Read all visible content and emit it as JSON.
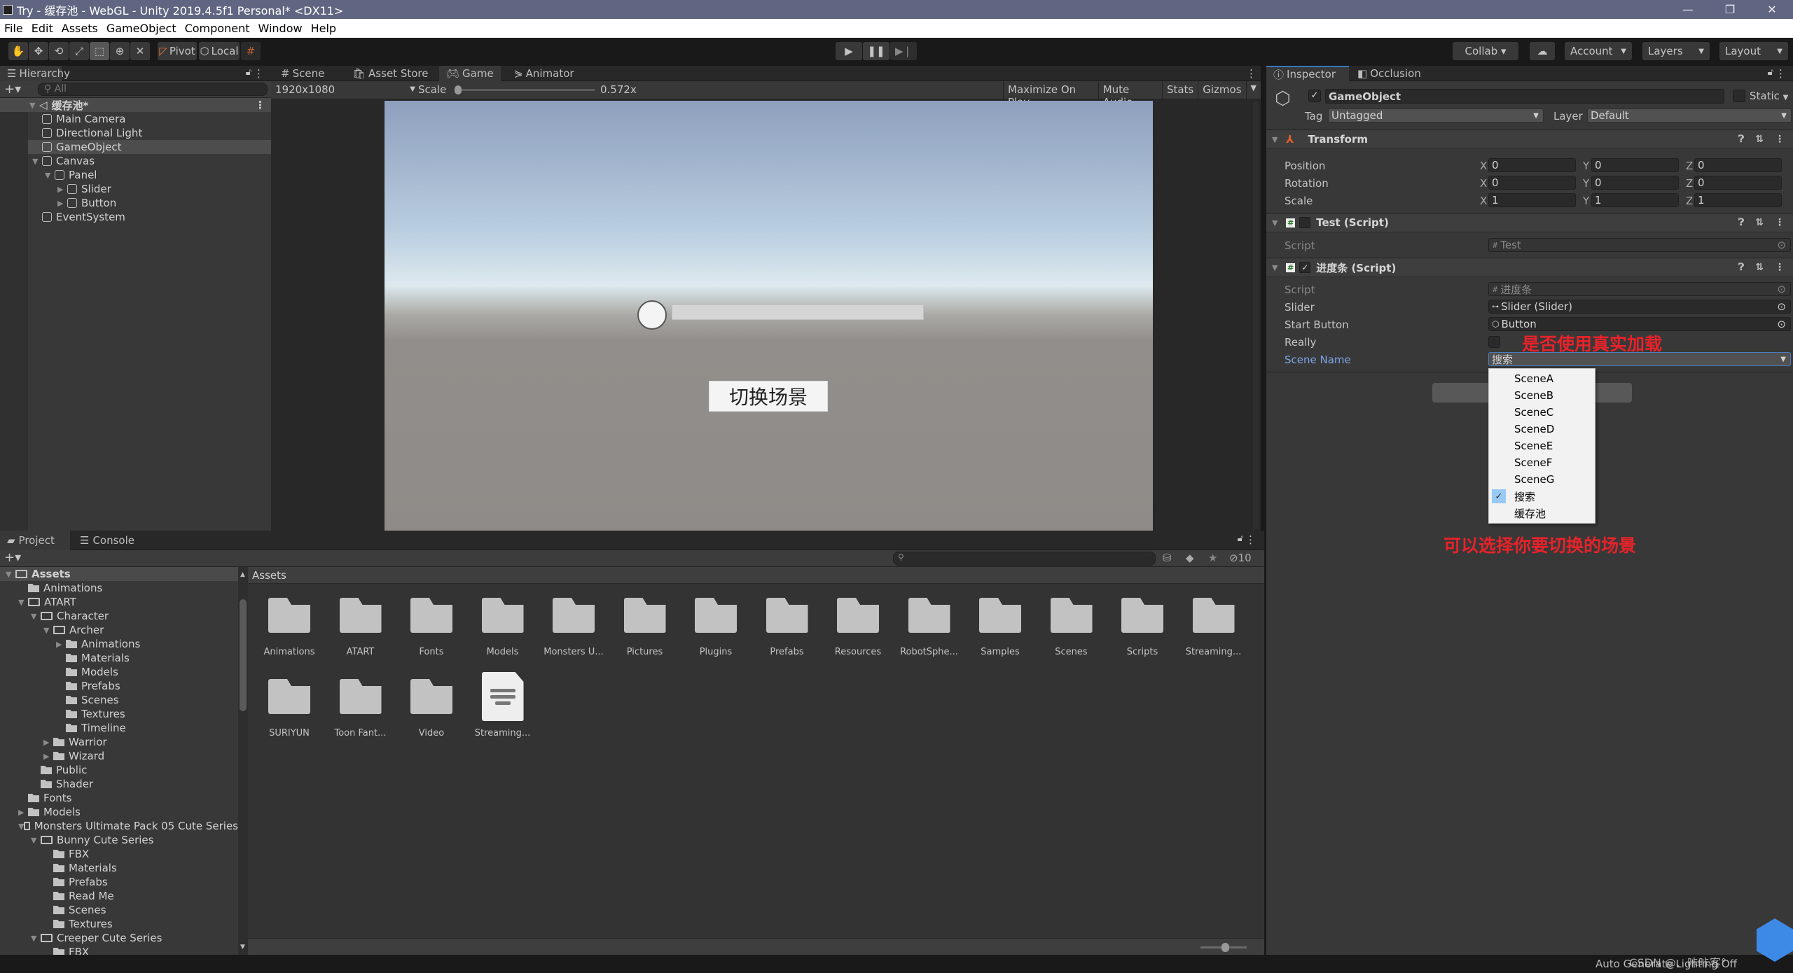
{
  "window": {
    "title": "Try - 缓存池 - WebGL - Unity 2019.4.5f1 Personal* <DX11>",
    "controls": {
      "minimize": "—",
      "restore": "❐",
      "close": "✕"
    }
  },
  "menu": [
    "File",
    "Edit",
    "Assets",
    "GameObject",
    "Component",
    "Window",
    "Help"
  ],
  "toolbar": {
    "pivot": "Pivot",
    "local": "Local",
    "collab": "Collab ▾",
    "account": "Account",
    "layers": "Layers",
    "layout": "Layout",
    "play_state": "paused"
  },
  "hierarchy": {
    "tab": "Hierarchy",
    "search_placeholder": "All",
    "scene": "缓存池*",
    "items": [
      {
        "label": "Main Camera",
        "depth": 1,
        "arrow": ""
      },
      {
        "label": "Directional Light",
        "depth": 1,
        "arrow": ""
      },
      {
        "label": "GameObject",
        "depth": 1,
        "arrow": "",
        "selected": true
      },
      {
        "label": "Canvas",
        "depth": 1,
        "arrow": "▼"
      },
      {
        "label": "Panel",
        "depth": 2,
        "arrow": "▼"
      },
      {
        "label": "Slider",
        "depth": 3,
        "arrow": "▶"
      },
      {
        "label": "Button",
        "depth": 3,
        "arrow": "▶"
      },
      {
        "label": "EventSystem",
        "depth": 1,
        "arrow": ""
      }
    ]
  },
  "game_view": {
    "tabs": [
      "Scene",
      "Asset Store",
      "Game",
      "Animator"
    ],
    "active_tab": "Game",
    "resolution": "1920x1080",
    "scale_label": "Scale",
    "scale_value": "0.572x",
    "options": [
      "Maximize On Play",
      "Mute Audio",
      "Stats",
      "Gizmos"
    ],
    "slider_value": 0.0,
    "button_label": "切换场景"
  },
  "project": {
    "tabs": [
      "Project",
      "Console"
    ],
    "tree": [
      {
        "label": "Assets",
        "depth": 0,
        "arrow": "▼",
        "open": true,
        "bold": true
      },
      {
        "label": "Animations",
        "depth": 1,
        "arrow": ""
      },
      {
        "label": "ATART",
        "depth": 1,
        "arrow": "▼",
        "open": true
      },
      {
        "label": "Character",
        "depth": 2,
        "arrow": "▼",
        "open": true
      },
      {
        "label": "Archer",
        "depth": 3,
        "arrow": "▼",
        "open": true
      },
      {
        "label": "Animations",
        "depth": 4,
        "arrow": "▶"
      },
      {
        "label": "Materials",
        "depth": 4,
        "arrow": ""
      },
      {
        "label": "Models",
        "depth": 4,
        "arrow": ""
      },
      {
        "label": "Prefabs",
        "depth": 4,
        "arrow": ""
      },
      {
        "label": "Scenes",
        "depth": 4,
        "arrow": ""
      },
      {
        "label": "Textures",
        "depth": 4,
        "arrow": ""
      },
      {
        "label": "Timeline",
        "depth": 4,
        "arrow": ""
      },
      {
        "label": "Warrior",
        "depth": 3,
        "arrow": "▶"
      },
      {
        "label": "Wizard",
        "depth": 3,
        "arrow": "▶"
      },
      {
        "label": "Public",
        "depth": 2,
        "arrow": ""
      },
      {
        "label": "Shader",
        "depth": 2,
        "arrow": ""
      },
      {
        "label": "Fonts",
        "depth": 1,
        "arrow": ""
      },
      {
        "label": "Models",
        "depth": 1,
        "arrow": "▶"
      },
      {
        "label": "Monsters Ultimate Pack 05 Cute Series",
        "depth": 1,
        "arrow": "▼",
        "open": true
      },
      {
        "label": "Bunny Cute Series",
        "depth": 2,
        "arrow": "▼",
        "open": true
      },
      {
        "label": "FBX",
        "depth": 3,
        "arrow": ""
      },
      {
        "label": "Materials",
        "depth": 3,
        "arrow": ""
      },
      {
        "label": "Prefabs",
        "depth": 3,
        "arrow": ""
      },
      {
        "label": "Read Me",
        "depth": 3,
        "arrow": ""
      },
      {
        "label": "Scenes",
        "depth": 3,
        "arrow": ""
      },
      {
        "label": "Textures",
        "depth": 3,
        "arrow": ""
      },
      {
        "label": "Creeper Cute Series",
        "depth": 2,
        "arrow": "▼",
        "open": true
      },
      {
        "label": "FBX",
        "depth": 3,
        "arrow": ""
      }
    ],
    "breadcrumb": "Assets",
    "hidden_count": "10",
    "assets": [
      {
        "name": "Animations",
        "type": "folder"
      },
      {
        "name": "ATART",
        "type": "folder"
      },
      {
        "name": "Fonts",
        "type": "folder"
      },
      {
        "name": "Models",
        "type": "folder"
      },
      {
        "name": "Monsters U...",
        "type": "folder"
      },
      {
        "name": "Pictures",
        "type": "folder"
      },
      {
        "name": "Plugins",
        "type": "folder"
      },
      {
        "name": "Prefabs",
        "type": "folder"
      },
      {
        "name": "Resources",
        "type": "folder"
      },
      {
        "name": "RobotSphe...",
        "type": "folder"
      },
      {
        "name": "Samples",
        "type": "folder"
      },
      {
        "name": "Scenes",
        "type": "folder"
      },
      {
        "name": "Scripts",
        "type": "folder"
      },
      {
        "name": "Streaming...",
        "type": "folder"
      },
      {
        "name": "SURIYUN",
        "type": "folder"
      },
      {
        "name": "Toon Fant...",
        "type": "folder"
      },
      {
        "name": "Video",
        "type": "folder"
      },
      {
        "name": "Streaming...",
        "type": "file"
      }
    ]
  },
  "inspector": {
    "tabs": [
      "Inspector",
      "Occlusion"
    ],
    "object_name": "GameObject",
    "static_label": "Static",
    "tag_label": "Tag",
    "tag_value": "Untagged",
    "layer_label": "Layer",
    "layer_value": "Default",
    "transform": {
      "title": "Transform",
      "rows": [
        {
          "label": "Position",
          "x": "0",
          "y": "0",
          "z": "0"
        },
        {
          "label": "Rotation",
          "x": "0",
          "y": "0",
          "z": "0"
        },
        {
          "label": "Scale",
          "x": "1",
          "y": "1",
          "z": "1"
        }
      ]
    },
    "test_script": {
      "title": "Test (Script)",
      "enabled": false,
      "script_label": "Script",
      "script_value": "Test"
    },
    "progress_script": {
      "title": "进度条 (Script)",
      "enabled": true,
      "script_label": "Script",
      "script_value": "进度条",
      "slider_label": "Slider",
      "slider_value": "Slider (Slider)",
      "start_button_label": "Start Button",
      "start_button_value": "Button",
      "really_label": "Really",
      "really_checked": false,
      "scene_name_label": "Scene Name",
      "scene_name_value": "搜索"
    },
    "dropdown_options": [
      "SceneA",
      "SceneB",
      "SceneC",
      "SceneD",
      "SceneE",
      "SceneF",
      "SceneG",
      "搜索",
      "缓存池"
    ],
    "dropdown_selected": "搜索"
  },
  "annotations": {
    "really_note": "是否使用真实加载",
    "scene_note": "可以选择你要切换的场景",
    "color": "#e8222a"
  },
  "status_bar": {
    "right_text": "Auto Generate Lighting Off",
    "watermark": "CSDN @、咔咔客°"
  }
}
